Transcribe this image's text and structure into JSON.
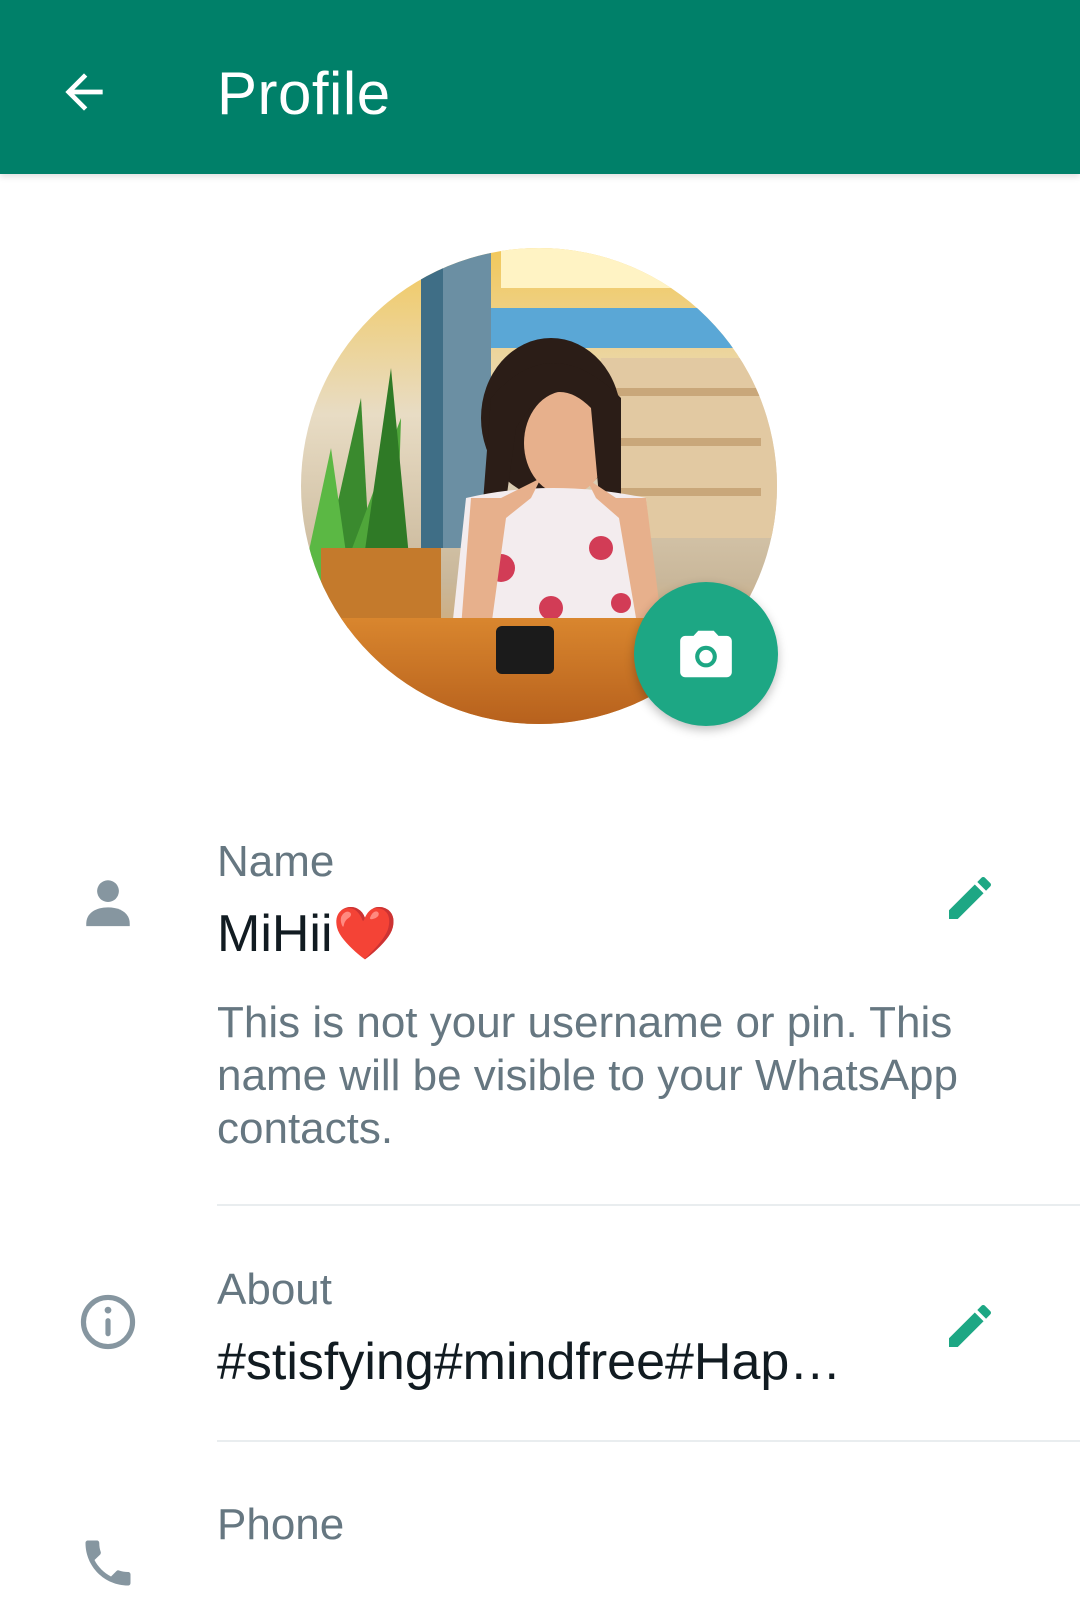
{
  "header": {
    "title": "Profile",
    "back_icon": "arrow-left-icon",
    "background_color": "#008069"
  },
  "profile_photo": {
    "camera_icon": "camera-icon",
    "fab_color": "#1da784"
  },
  "name": {
    "label": "Name",
    "value": "MiHii❤️",
    "hint": "This is not your username or pin. This name will be visible to your WhatsApp contacts.",
    "icon": "person-icon",
    "edit_icon": "pencil-icon"
  },
  "about": {
    "label": "About",
    "value": "#stisfying#mindfree#Hap…",
    "icon": "info-icon",
    "edit_icon": "pencil-icon"
  },
  "phone": {
    "label": "Phone",
    "icon": "phone-icon"
  }
}
